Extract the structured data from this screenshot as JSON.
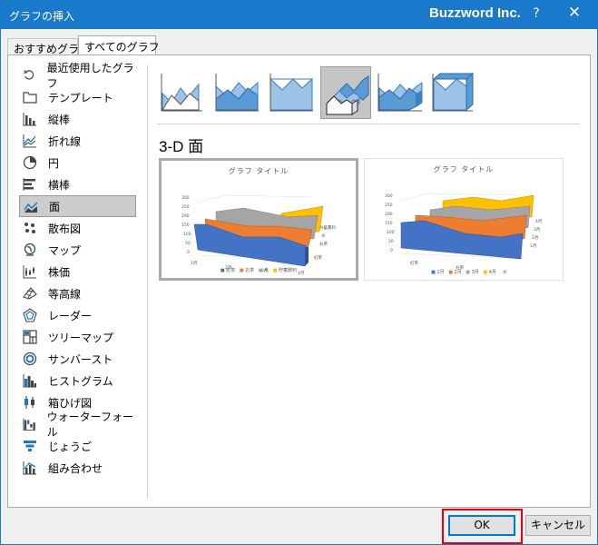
{
  "window": {
    "title": "グラフの挿入",
    "brand": "Buzzword Inc.",
    "help": "?",
    "close": "✕"
  },
  "tabs": [
    {
      "label": "おすすめグラフ",
      "active": false
    },
    {
      "label": "すべてのグラフ",
      "active": true
    }
  ],
  "sidebar": {
    "items": [
      {
        "label": "最近使用したグラフ",
        "icon": "recent-icon",
        "selected": false
      },
      {
        "label": "テンプレート",
        "icon": "folder-icon",
        "selected": false
      },
      {
        "label": "縦棒",
        "icon": "column-chart-icon",
        "selected": false
      },
      {
        "label": "折れ線",
        "icon": "line-chart-icon",
        "selected": false
      },
      {
        "label": "円",
        "icon": "pie-chart-icon",
        "selected": false
      },
      {
        "label": "横棒",
        "icon": "bar-chart-icon",
        "selected": false
      },
      {
        "label": "面",
        "icon": "area-chart-icon",
        "selected": true
      },
      {
        "label": "散布図",
        "icon": "scatter-chart-icon",
        "selected": false
      },
      {
        "label": "マップ",
        "icon": "map-chart-icon",
        "selected": false
      },
      {
        "label": "株価",
        "icon": "stock-chart-icon",
        "selected": false
      },
      {
        "label": "等高線",
        "icon": "surface-chart-icon",
        "selected": false
      },
      {
        "label": "レーダー",
        "icon": "radar-chart-icon",
        "selected": false
      },
      {
        "label": "ツリーマップ",
        "icon": "treemap-chart-icon",
        "selected": false
      },
      {
        "label": "サンバースト",
        "icon": "sunburst-chart-icon",
        "selected": false
      },
      {
        "label": "ヒストグラム",
        "icon": "histogram-chart-icon",
        "selected": false
      },
      {
        "label": "箱ひげ図",
        "icon": "box-whisker-chart-icon",
        "selected": false
      },
      {
        "label": "ウォーターフォール",
        "icon": "waterfall-chart-icon",
        "selected": false
      },
      {
        "label": "じょうご",
        "icon": "funnel-chart-icon",
        "selected": false
      },
      {
        "label": "組み合わせ",
        "icon": "combo-chart-icon",
        "selected": false
      }
    ]
  },
  "subtypes": {
    "selected_index": 3,
    "heading": "3-D 面"
  },
  "previews": [
    {
      "title": "グラフ タイトル",
      "y_ticks": [
        "300",
        "250",
        "200",
        "150",
        "100",
        "50",
        "0"
      ],
      "x_ticks": [
        "1月",
        "2月",
        "3月",
        "4月"
      ],
      "depth_labels": [
        "貯蓄費料",
        "水",
        "お茶",
        "紅茶"
      ],
      "legend": [
        "紅茶",
        "お茶",
        "水",
        "貯蓄飲料"
      ],
      "selected": true
    },
    {
      "title": "グラフ タイトル",
      "y_ticks": [
        "300",
        "250",
        "200",
        "150",
        "100",
        "50",
        "0"
      ],
      "x_ticks": [
        "紅茶",
        "お茶",
        "水"
      ],
      "depth_labels": [
        "4月",
        "3月",
        "2月",
        "1月"
      ],
      "legend": [
        "1月",
        "2月",
        "3月",
        "4月"
      ],
      "selected": false
    }
  ],
  "colors": {
    "title_bar": "#1979ca",
    "series": [
      "#4472c4",
      "#ed7d31",
      "#a5a5a5",
      "#ffc000"
    ],
    "highlight": "#e60012"
  },
  "buttons": {
    "ok": "OK",
    "cancel": "キャンセル"
  }
}
